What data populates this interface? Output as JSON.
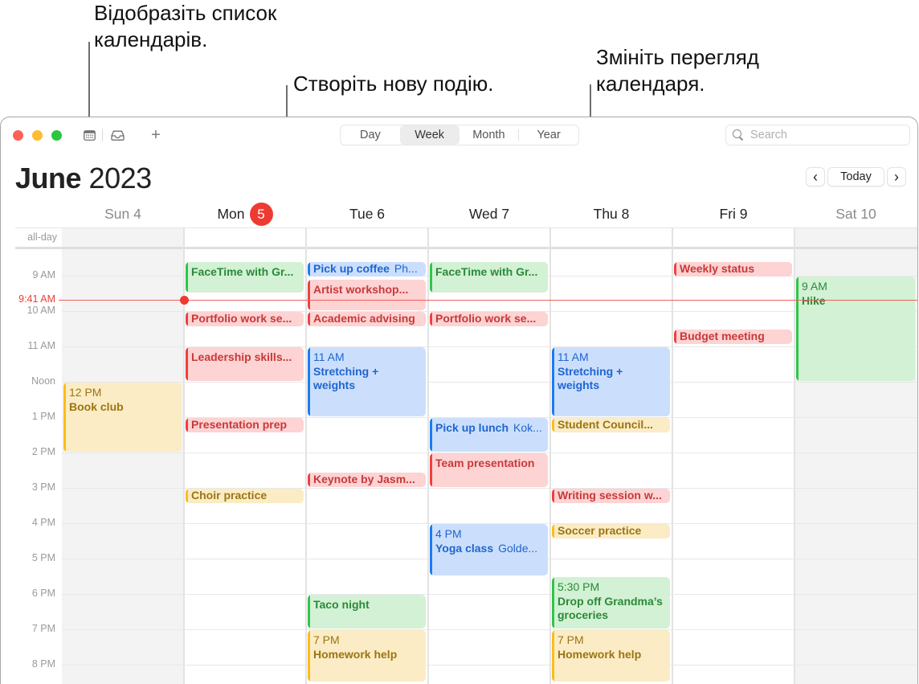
{
  "callouts": {
    "calendar_list": [
      "Відобразіть список",
      "календарів."
    ],
    "new_event": "Створіть нову подію.",
    "change_view": [
      "Змініть перегляд",
      "календаря."
    ]
  },
  "toolbar": {
    "icons": [
      "calendar-list-icon",
      "inbox-icon",
      "plus-icon"
    ],
    "add_label": "+",
    "view_tabs": [
      {
        "label": "Day",
        "active": false
      },
      {
        "label": "Week",
        "active": true
      },
      {
        "label": "Month",
        "active": false
      },
      {
        "label": "Year",
        "active": false
      }
    ],
    "search_placeholder": "Search"
  },
  "header": {
    "month": "June",
    "year": "2023",
    "prev_label": "‹",
    "today_label": "Today",
    "next_label": "›"
  },
  "days": [
    {
      "name": "Sun",
      "date": "4",
      "weekend": true,
      "today": false
    },
    {
      "name": "Mon",
      "date": "5",
      "weekend": false,
      "today": true
    },
    {
      "name": "Tue",
      "date": "6",
      "weekend": false,
      "today": false
    },
    {
      "name": "Wed",
      "date": "7",
      "weekend": false,
      "today": false
    },
    {
      "name": "Thu",
      "date": "8",
      "weekend": false,
      "today": false
    },
    {
      "name": "Fri",
      "date": "9",
      "weekend": false,
      "today": false
    },
    {
      "name": "Sat",
      "date": "10",
      "weekend": true,
      "today": false
    }
  ],
  "allday_label": "all-day",
  "hours": [
    "9 AM",
    "10 AM",
    "11 AM",
    "Noon",
    "1 PM",
    "2 PM",
    "3 PM",
    "4 PM",
    "5 PM",
    "6 PM",
    "7 PM",
    "8 PM"
  ],
  "now": {
    "label": "9:41 AM",
    "time": 9.683
  },
  "colors": {
    "green": "#2fc54a",
    "red": "#f23e3e",
    "blue": "#1a7bf5",
    "yellow": "#fbbd18",
    "today_badge": "#ee3b32"
  },
  "events": [
    {
      "day": 0,
      "start": 12.0,
      "end": 14.0,
      "color": "yellow",
      "time": "12 PM",
      "title": "Book club",
      "location": ""
    },
    {
      "day": 1,
      "start": 8.6,
      "end": 9.5,
      "color": "green",
      "time": "",
      "title": "FaceTime with Gr...",
      "location": ""
    },
    {
      "day": 1,
      "start": 10.0,
      "end": 10.45,
      "color": "red",
      "time": "",
      "title": "Portfolio work se...",
      "location": ""
    },
    {
      "day": 1,
      "start": 11.0,
      "end": 12.0,
      "color": "red",
      "time": "",
      "title": "Leadership skills...",
      "location": ""
    },
    {
      "day": 1,
      "start": 13.0,
      "end": 13.45,
      "color": "red",
      "time": "",
      "title": "Presentation prep",
      "location": ""
    },
    {
      "day": 1,
      "start": 15.0,
      "end": 15.45,
      "color": "yellow",
      "time": "",
      "title": "Choir practice",
      "location": ""
    },
    {
      "day": 2,
      "start": 8.6,
      "end": 9.05,
      "color": "blue",
      "time": "",
      "title": "Pick up coffee",
      "location": "Ph..."
    },
    {
      "day": 2,
      "start": 9.1,
      "end": 10.0,
      "color": "red",
      "time": "",
      "title": "Artist workshop...",
      "location": ""
    },
    {
      "day": 2,
      "start": 10.0,
      "end": 10.45,
      "color": "red",
      "time": "",
      "title": "Academic advising",
      "location": ""
    },
    {
      "day": 2,
      "start": 11.0,
      "end": 13.0,
      "color": "blue",
      "time": "11 AM",
      "title": "Stretching + weights",
      "location": ""
    },
    {
      "day": 2,
      "start": 14.55,
      "end": 15.0,
      "color": "red",
      "time": "",
      "title": "Keynote by Jasm...",
      "location": ""
    },
    {
      "day": 2,
      "start": 18.0,
      "end": 19.0,
      "color": "green",
      "time": "",
      "title": "Taco night",
      "location": ""
    },
    {
      "day": 2,
      "start": 19.0,
      "end": 20.5,
      "color": "yellow",
      "time": "7 PM",
      "title": "Homework help",
      "location": ""
    },
    {
      "day": 3,
      "start": 8.6,
      "end": 9.5,
      "color": "green",
      "time": "",
      "title": "FaceTime with Gr...",
      "location": ""
    },
    {
      "day": 3,
      "start": 10.0,
      "end": 10.45,
      "color": "red",
      "time": "",
      "title": "Portfolio work se...",
      "location": ""
    },
    {
      "day": 3,
      "start": 13.0,
      "end": 14.0,
      "color": "blue",
      "time": "",
      "title": "Pick up lunch",
      "location": "Kok..."
    },
    {
      "day": 3,
      "start": 14.0,
      "end": 15.0,
      "color": "red",
      "time": "",
      "title": "Team presentation",
      "location": ""
    },
    {
      "day": 3,
      "start": 16.0,
      "end": 17.5,
      "color": "blue",
      "time": "4 PM",
      "title": "Yoga class",
      "location": "Golde..."
    },
    {
      "day": 4,
      "start": 11.0,
      "end": 13.0,
      "color": "blue",
      "time": "11 AM",
      "title": "Stretching + weights",
      "location": ""
    },
    {
      "day": 4,
      "start": 13.0,
      "end": 13.45,
      "color": "yellow",
      "time": "",
      "title": "Student Council...",
      "location": ""
    },
    {
      "day": 4,
      "start": 15.0,
      "end": 15.45,
      "color": "red",
      "time": "",
      "title": "Writing session w...",
      "location": ""
    },
    {
      "day": 4,
      "start": 16.0,
      "end": 16.45,
      "color": "yellow",
      "time": "",
      "title": "Soccer practice",
      "location": ""
    },
    {
      "day": 4,
      "start": 17.5,
      "end": 19.0,
      "color": "green",
      "time": "5:30 PM",
      "title": "Drop off Grandma’s groceries",
      "location": ""
    },
    {
      "day": 4,
      "start": 19.0,
      "end": 20.5,
      "color": "yellow",
      "time": "7 PM",
      "title": "Homework help",
      "location": ""
    },
    {
      "day": 5,
      "start": 8.6,
      "end": 9.05,
      "color": "red",
      "time": "",
      "title": "Weekly status",
      "location": ""
    },
    {
      "day": 5,
      "start": 10.5,
      "end": 10.95,
      "color": "red",
      "time": "",
      "title": "Budget meeting",
      "location": ""
    },
    {
      "day": 6,
      "start": 9.0,
      "end": 12.0,
      "color": "green",
      "time": "9 AM",
      "title": "Hike",
      "location": ""
    }
  ]
}
